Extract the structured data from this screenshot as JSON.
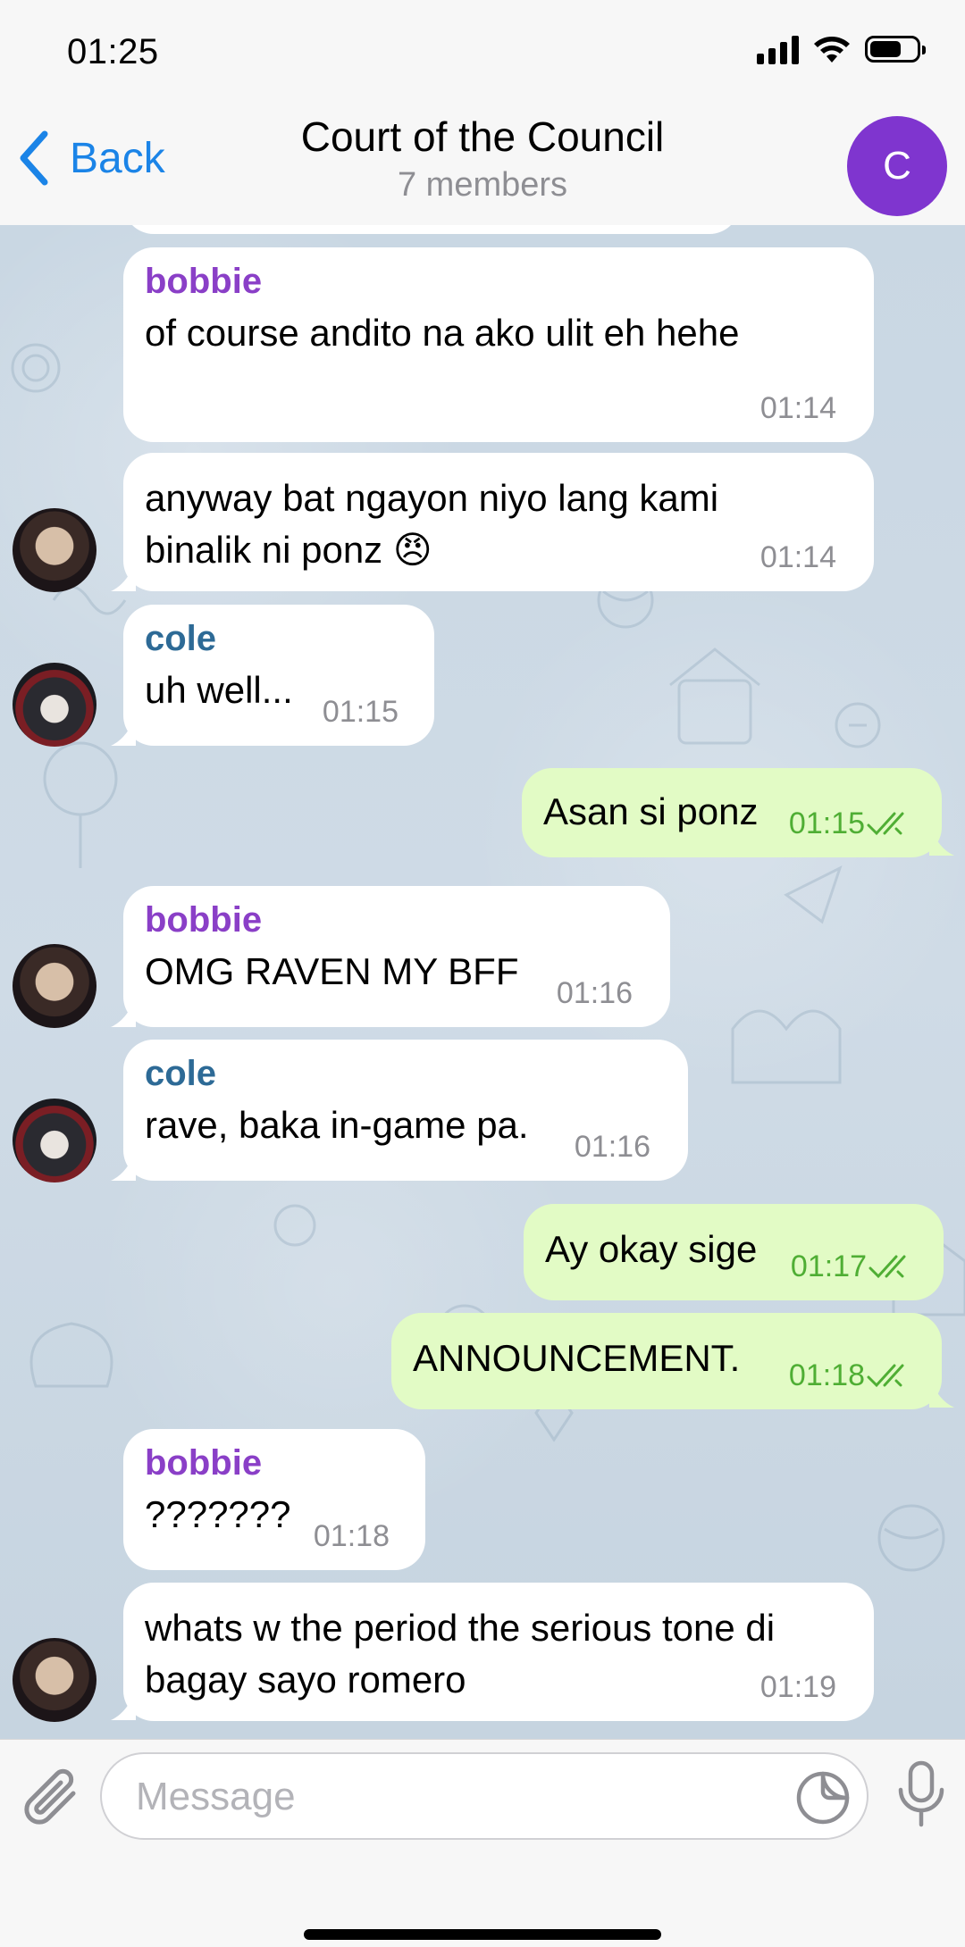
{
  "status_bar": {
    "time": "01:25"
  },
  "header": {
    "back_label": "Back",
    "title": "Court of the Council",
    "subtitle": "7 members",
    "avatar_letter": "C",
    "avatar_color": "#7f35cf"
  },
  "messages": [
    {
      "sender": "bobbie",
      "text": "of course andito na ako ulit eh hehe",
      "time": "01:14",
      "direction": "in"
    },
    {
      "sender": "",
      "text_line1": "anyway bat ngayon niyo lang kami",
      "text_line2": "binalik ni ponz 😠",
      "time": "01:14",
      "direction": "in"
    },
    {
      "sender": "cole",
      "text": "uh well...",
      "time": "01:15",
      "direction": "in"
    },
    {
      "text": "Asan si ponz",
      "time": "01:15",
      "direction": "out",
      "status": "read"
    },
    {
      "sender": "bobbie",
      "text": "OMG RAVEN MY BFF",
      "time": "01:16",
      "direction": "in"
    },
    {
      "sender": "cole",
      "text": "rave, baka in-game pa.",
      "time": "01:16",
      "direction": "in"
    },
    {
      "text": "Ay okay sige",
      "time": "01:17",
      "direction": "out",
      "status": "read"
    },
    {
      "text": "ANNOUNCEMENT.",
      "time": "01:18",
      "direction": "out",
      "status": "read"
    },
    {
      "sender": "bobbie",
      "text": "???????",
      "time": "01:18",
      "direction": "in"
    },
    {
      "sender": "",
      "text_line1": "whats w the period the serious tone di",
      "text_line2": "bagay sayo romero",
      "time": "01:19",
      "direction": "in"
    }
  ],
  "input": {
    "placeholder": "Message"
  },
  "colors": {
    "accent": "#1b84e7",
    "outgoing_bubble": "#e2fbc5",
    "read_check": "#4fae34",
    "bobbie_name": "#8a3fc7",
    "cole_name": "#2d6a96"
  }
}
